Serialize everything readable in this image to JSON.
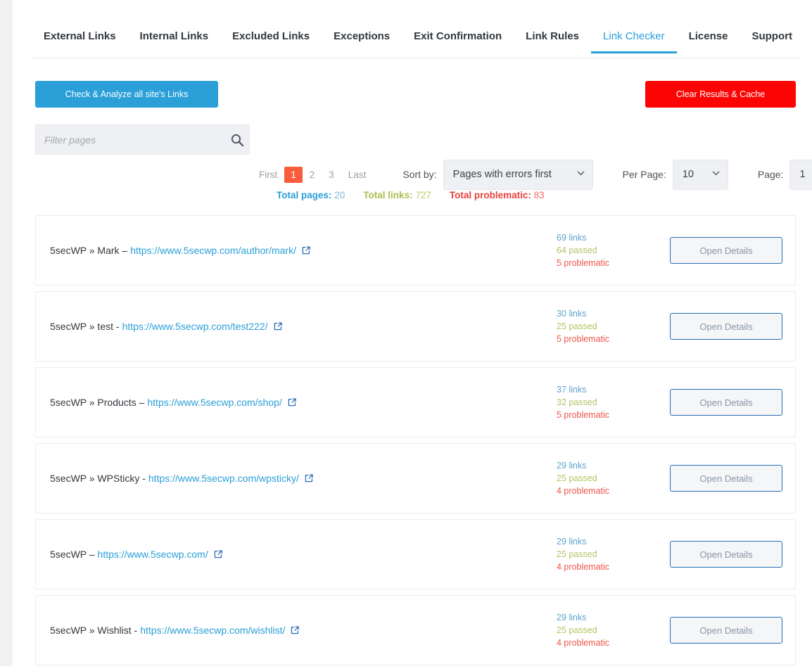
{
  "tabs": [
    {
      "label": "External Links",
      "active": false
    },
    {
      "label": "Internal Links",
      "active": false
    },
    {
      "label": "Excluded Links",
      "active": false
    },
    {
      "label": "Exceptions",
      "active": false
    },
    {
      "label": "Exit Confirmation",
      "active": false
    },
    {
      "label": "Link Rules",
      "active": false
    },
    {
      "label": "Link Checker",
      "active": true
    },
    {
      "label": "License",
      "active": false
    },
    {
      "label": "Support",
      "active": false
    }
  ],
  "actions": {
    "analyze_label": "Check & Analyze all site's Links",
    "clear_label": "Clear Results & Cache",
    "analyze_color": "#2a9fd8",
    "clear_color": "#fc0404"
  },
  "filter": {
    "placeholder": "Filter pages",
    "value": "",
    "icon": "search-icon"
  },
  "pagination": {
    "first_label": "First",
    "last_label": "Last",
    "pages": [
      "1",
      "2",
      "3"
    ],
    "current": "1",
    "current_color": "#f95d3c"
  },
  "controls": {
    "sort_label": "Sort by:",
    "sort_value": "Pages with errors first",
    "per_page_label": "Per Page:",
    "per_page_value": "10",
    "page_label": "Page:",
    "page_value": "1"
  },
  "totals": {
    "pages_label": "Total pages:",
    "pages_value": "20",
    "links_label": "Total links:",
    "links_value": "727",
    "problematic_label": "Total problematic:",
    "problematic_value": "83",
    "pages_color": "#2a9fd8",
    "links_color": "#a8bf4e",
    "problematic_color": "#e8413a"
  },
  "open_details_label": "Open Details",
  "rows": [
    {
      "title": "5secWP » Mark –",
      "url": "https://www.5secwp.com/author/mark/",
      "links": "69 links",
      "passed": "64 passed",
      "problematic": "5 problematic"
    },
    {
      "title": "5secWP » test -",
      "url": "https://www.5secwp.com/test222/",
      "links": "30 links",
      "passed": "25 passed",
      "problematic": "5 problematic"
    },
    {
      "title": "5secWP » Products –",
      "url": "https://www.5secwp.com/shop/",
      "links": "37 links",
      "passed": "32 passed",
      "problematic": "5 problematic"
    },
    {
      "title": "5secWP » WPSticky -",
      "url": "https://www.5secwp.com/wpsticky/",
      "links": "29 links",
      "passed": "25 passed",
      "problematic": "4 problematic"
    },
    {
      "title": "5secWP –",
      "url": "https://www.5secwp.com/",
      "links": "29 links",
      "passed": "25 passed",
      "problematic": "4 problematic"
    },
    {
      "title": "5secWP » Wishlist -",
      "url": "https://www.5secwp.com/wishlist/",
      "links": "29 links",
      "passed": "25 passed",
      "problematic": "4 problematic"
    }
  ]
}
